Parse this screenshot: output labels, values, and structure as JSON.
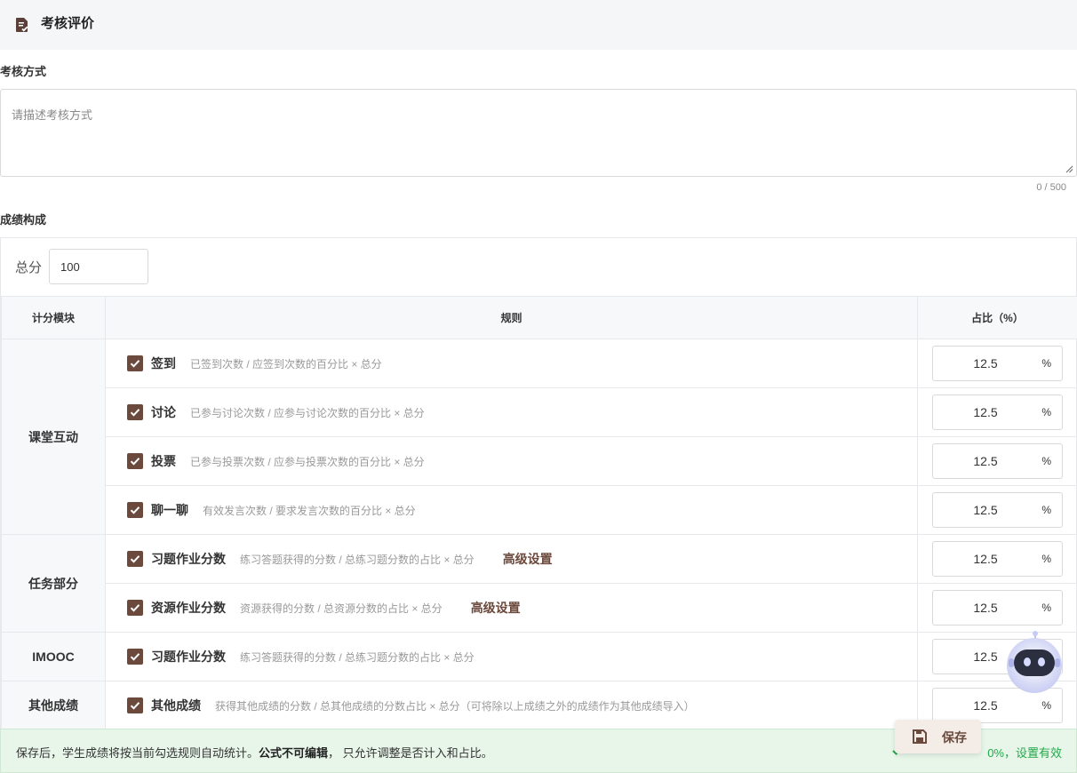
{
  "header": {
    "title": "考核评价",
    "icon": "document-check-icon"
  },
  "assessment": {
    "label": "考核方式",
    "placeholder": "请描述考核方式",
    "value": "",
    "counter": "0 / 500"
  },
  "grade": {
    "label": "成绩构成",
    "total_label": "总分",
    "total_value": "100",
    "columns": {
      "module": "计分模块",
      "rule": "规则",
      "ratio": "占比（%）"
    },
    "unit": "%",
    "advanced_label": "高级设置",
    "modules": [
      {
        "name": "课堂互动",
        "rules": [
          {
            "name": "签到",
            "desc": "已签到次数 / 应签到次数的百分比 × 总分",
            "ratio": "12.5",
            "checked": true
          },
          {
            "name": "讨论",
            "desc": "已参与讨论次数 / 应参与讨论次数的百分比 × 总分",
            "ratio": "12.5",
            "checked": true
          },
          {
            "name": "投票",
            "desc": "已参与投票次数 / 应参与投票次数的百分比 × 总分",
            "ratio": "12.5",
            "checked": true
          },
          {
            "name": "聊一聊",
            "desc": "有效发言次数 / 要求发言次数的百分比 × 总分",
            "ratio": "12.5",
            "checked": true
          }
        ]
      },
      {
        "name": "任务部分",
        "rules": [
          {
            "name": "习题作业分数",
            "desc": "练习答题获得的分数 / 总练习题分数的占比 × 总分",
            "ratio": "12.5",
            "checked": true,
            "advanced": true
          },
          {
            "name": "资源作业分数",
            "desc": "资源获得的分数 / 总资源分数的占比 × 总分",
            "ratio": "12.5",
            "checked": true,
            "advanced": true
          }
        ]
      },
      {
        "name": "IMOOC",
        "rules": [
          {
            "name": "习题作业分数",
            "desc": "练习答题获得的分数 / 总练习题分数的占比 × 总分",
            "ratio": "12.5",
            "checked": true
          }
        ]
      },
      {
        "name": "其他成绩",
        "rules": [
          {
            "name": "其他成绩",
            "desc": "获得其他成绩的分数 / 总其他成绩的分数占比 × 总分（可将除以上成绩之外的成绩作为其他成绩导入）",
            "ratio": "12.5",
            "checked": true
          }
        ]
      }
    ]
  },
  "footer": {
    "message_prefix": "保存后，学生成绩将按当前勾选规则自动统计。",
    "message_bold": "公式不可编辑",
    "message_suffix": "， 只允许调整是否计入和占比。",
    "status": "0%，设置有效",
    "status_color": "#22a84a"
  },
  "save_button": {
    "label": "保存",
    "icon": "save-icon"
  },
  "assistant": {
    "icon": "robot-assistant-icon"
  },
  "colors": {
    "accent": "#6b4a3d",
    "footer_bg": "#e8f6ea",
    "header_bg": "#f5f6f8"
  }
}
